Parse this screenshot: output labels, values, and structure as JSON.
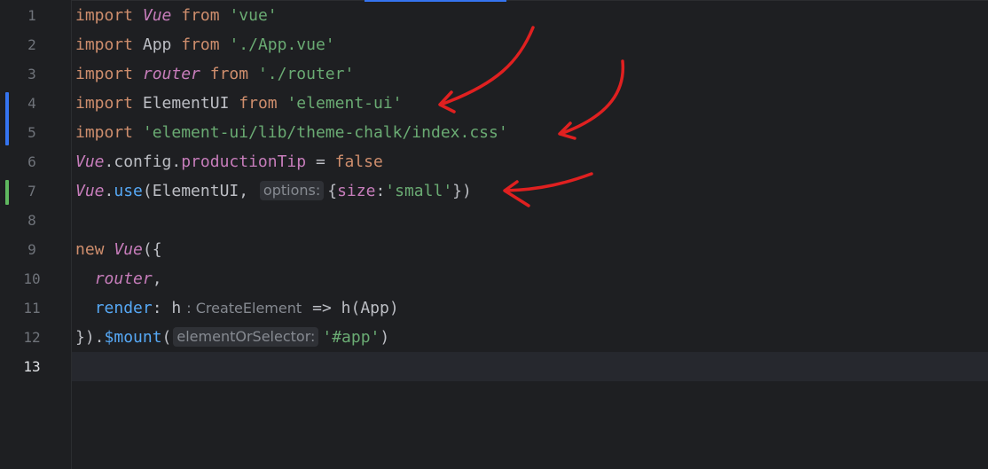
{
  "editor": {
    "accent_color": "#3574f0",
    "line_numbers": [
      "1",
      "2",
      "3",
      "4",
      "5",
      "6",
      "7",
      "8",
      "9",
      "10",
      "11",
      "12",
      "13"
    ],
    "current_line": "13"
  },
  "code": {
    "l1": {
      "kw": "import",
      "name": "Vue",
      "from": "from",
      "src": "'vue'"
    },
    "l2": {
      "kw": "import",
      "name": "App",
      "from": "from",
      "src": "'./App.vue'"
    },
    "l3": {
      "kw": "import",
      "name": "router",
      "from": "from",
      "src": "'./router'"
    },
    "l4": {
      "kw": "import",
      "name": "ElementUI",
      "from": "from",
      "src": "'element-ui'"
    },
    "l5": {
      "kw": "import",
      "src": "'element-ui/lib/theme-chalk/index.css'"
    },
    "l6": {
      "obj": "Vue",
      "dot": ".config.",
      "prop": "productionTip",
      "eq": " = ",
      "val": "false"
    },
    "l7": {
      "obj": "Vue",
      "dot": ".",
      "fn": "use",
      "open": "(ElementUI, ",
      "hint": "options:",
      "brace": "{",
      "key": "size",
      "colon": ":",
      "val": "'small'",
      "close": "})"
    },
    "l9": {
      "kw": "new",
      "cls": "Vue",
      "open": "({"
    },
    "l10": {
      "name": "router",
      "comma": ","
    },
    "l11": {
      "key": "render",
      "colon": ": ",
      "arg": "h",
      "hint": ": CreateElement",
      "arrow": "=> h(App)"
    },
    "l12": {
      "close": "}).",
      "fn": "$mount",
      "paren": "(",
      "hint": "elementOrSelector:",
      "val": "'#app'",
      "end": ")"
    }
  },
  "gutter_markers": {
    "modified_color": "#3574f0",
    "added_color": "#5fb85f"
  },
  "annotations": {
    "arrow_color": "#e02020"
  }
}
